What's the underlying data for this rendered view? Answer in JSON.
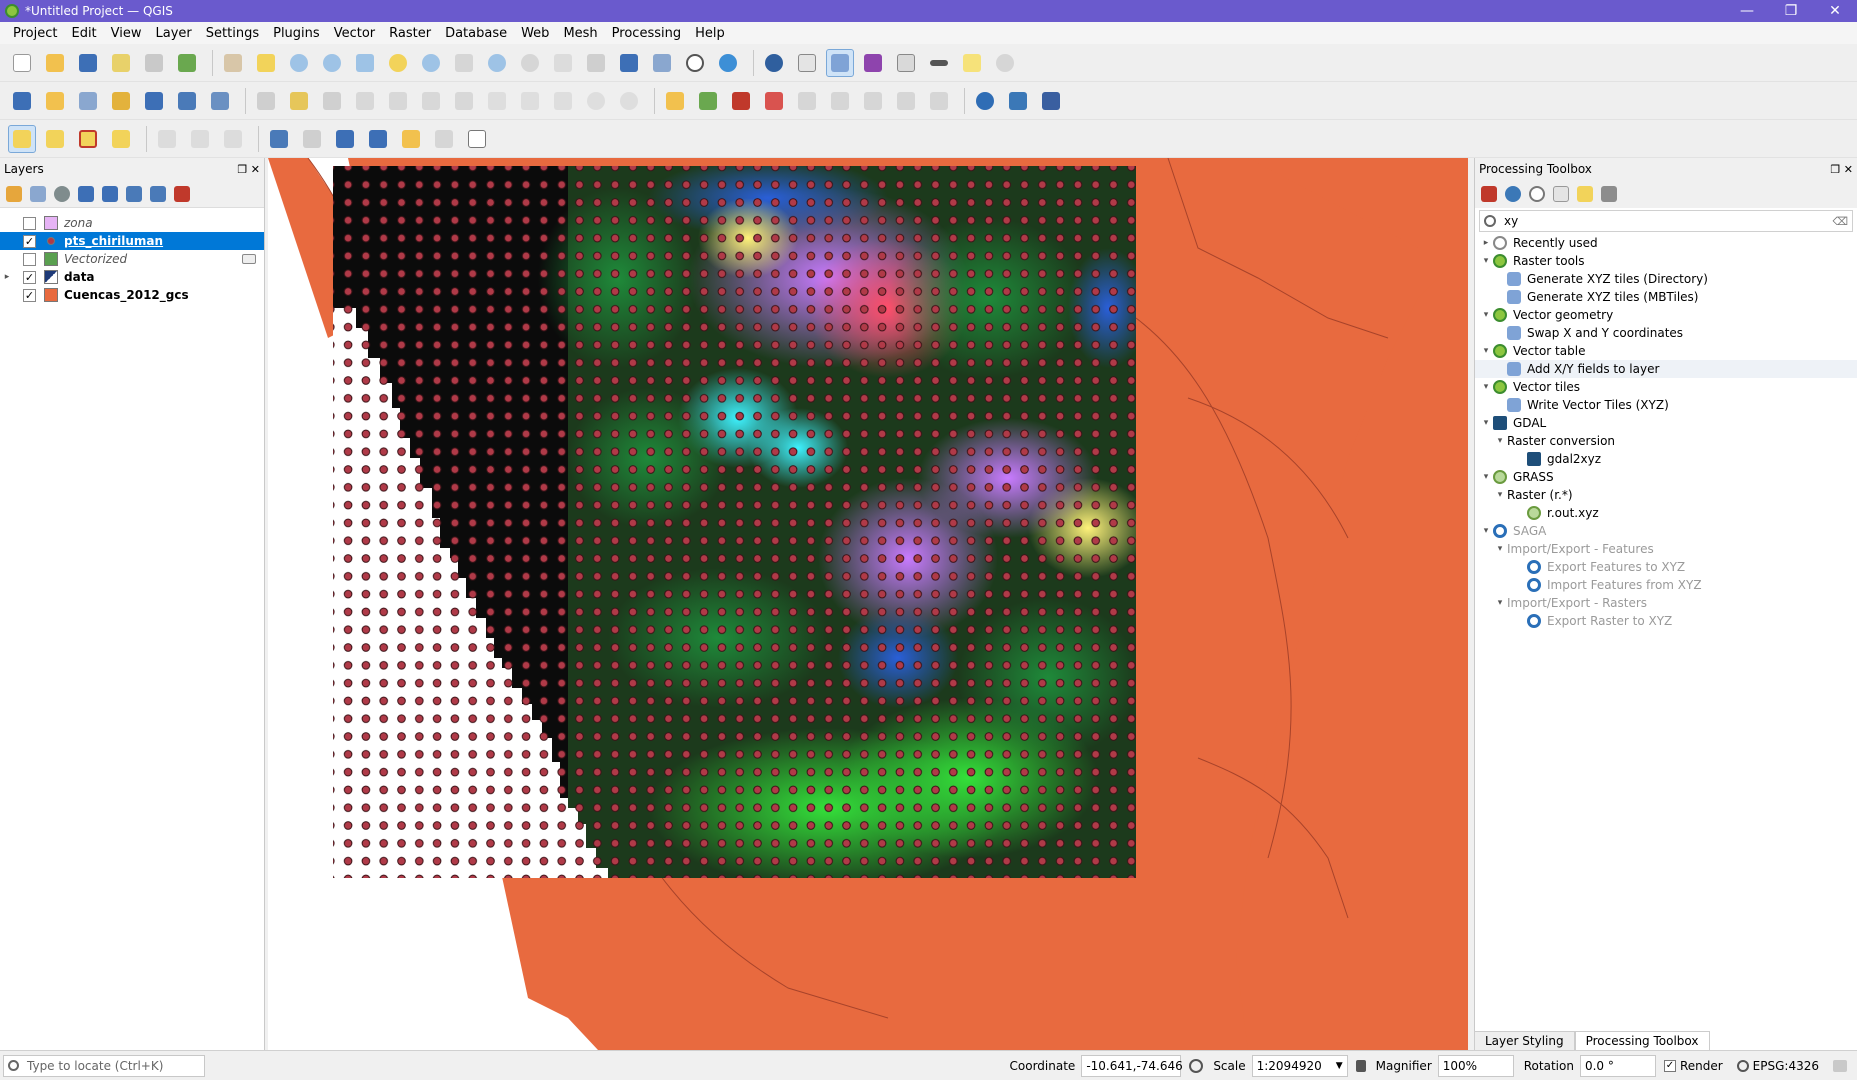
{
  "window": {
    "title": "*Untitled Project — QGIS",
    "minimize": "—",
    "maximize": "❐",
    "close": "✕"
  },
  "menu": [
    "Project",
    "Edit",
    "View",
    "Layer",
    "Settings",
    "Plugins",
    "Vector",
    "Raster",
    "Database",
    "Web",
    "Mesh",
    "Processing",
    "Help"
  ],
  "layers_panel": {
    "title": "Layers",
    "items": [
      {
        "label": "zona",
        "checked": false,
        "style": "italic",
        "symbol_color": "#e6b3f5"
      },
      {
        "label": "pts_chiriluman",
        "checked": true,
        "style": "bold",
        "selected": true,
        "symbol_color": "#b03a48"
      },
      {
        "label": "Vectorized",
        "checked": false,
        "style": "italic",
        "symbol_color": "#5aa050"
      },
      {
        "label": "data",
        "checked": true,
        "style": "bold",
        "symbol_color": "#1e3a78"
      },
      {
        "label": "Cuencas_2012_gcs",
        "checked": true,
        "style": "bold",
        "symbol_color": "#e86a3f"
      }
    ]
  },
  "toolbox": {
    "title": "Processing Toolbox",
    "search_value": "xy",
    "tree": [
      {
        "label": "Recently used",
        "level": 0,
        "icon": "clock",
        "arrow": "▸"
      },
      {
        "label": "Raster tools",
        "level": 0,
        "icon": "q",
        "arrow": "▾"
      },
      {
        "label": "Generate XYZ tiles (Directory)",
        "level": 1,
        "icon": "gear"
      },
      {
        "label": "Generate XYZ tiles (MBTiles)",
        "level": 1,
        "icon": "gear"
      },
      {
        "label": "Vector geometry",
        "level": 0,
        "icon": "q",
        "arrow": "▾"
      },
      {
        "label": "Swap X and Y coordinates",
        "level": 1,
        "icon": "gear"
      },
      {
        "label": "Vector table",
        "level": 0,
        "icon": "q",
        "arrow": "▾"
      },
      {
        "label": "Add X/Y fields to layer",
        "level": 1,
        "icon": "gear",
        "highlight": true
      },
      {
        "label": "Vector tiles",
        "level": 0,
        "icon": "q",
        "arrow": "▾"
      },
      {
        "label": "Write Vector Tiles (XYZ)",
        "level": 1,
        "icon": "gear"
      },
      {
        "label": "GDAL",
        "level": 0,
        "icon": "gdal",
        "arrow": "▾"
      },
      {
        "label": "Raster conversion",
        "level": 1,
        "icon": "none",
        "arrow": "▾"
      },
      {
        "label": "gdal2xyz",
        "level": 2,
        "icon": "gdal"
      },
      {
        "label": "GRASS",
        "level": 0,
        "icon": "grass",
        "arrow": "▾"
      },
      {
        "label": "Raster (r.*)",
        "level": 1,
        "icon": "none",
        "arrow": "▾"
      },
      {
        "label": "r.out.xyz",
        "level": 2,
        "icon": "grass"
      },
      {
        "label": "SAGA",
        "level": 0,
        "icon": "saga",
        "arrow": "▾",
        "dim": true
      },
      {
        "label": "Import/Export - Features",
        "level": 1,
        "icon": "none",
        "arrow": "▾",
        "dim": true
      },
      {
        "label": "Export Features to XYZ",
        "level": 2,
        "icon": "saga",
        "dim": true
      },
      {
        "label": "Import Features from XYZ",
        "level": 2,
        "icon": "saga",
        "dim": true
      },
      {
        "label": "Import/Export - Rasters",
        "level": 1,
        "icon": "none",
        "arrow": "▾",
        "dim": true
      },
      {
        "label": "Export Raster to XYZ",
        "level": 2,
        "icon": "saga",
        "dim": true
      }
    ]
  },
  "bottom_tabs": [
    "Layer Styling",
    "Processing Toolbox"
  ],
  "status": {
    "locate_placeholder": "Type to locate (Ctrl+K)",
    "coordinate_label": "Coordinate",
    "coordinate_value": "-10.641,-74.646",
    "scale_label": "Scale",
    "scale_value": "1:2094920",
    "magnifier_label": "Magnifier",
    "magnifier_value": "100%",
    "rotation_label": "Rotation",
    "rotation_value": "0.0 °",
    "render_label": "Render",
    "crs": "EPSG:4326"
  },
  "colors": {
    "title_bar": "#6a5acd",
    "selection": "#0078d7",
    "basin_fill": "#e86a3f",
    "point_fill": "#b03a48"
  }
}
